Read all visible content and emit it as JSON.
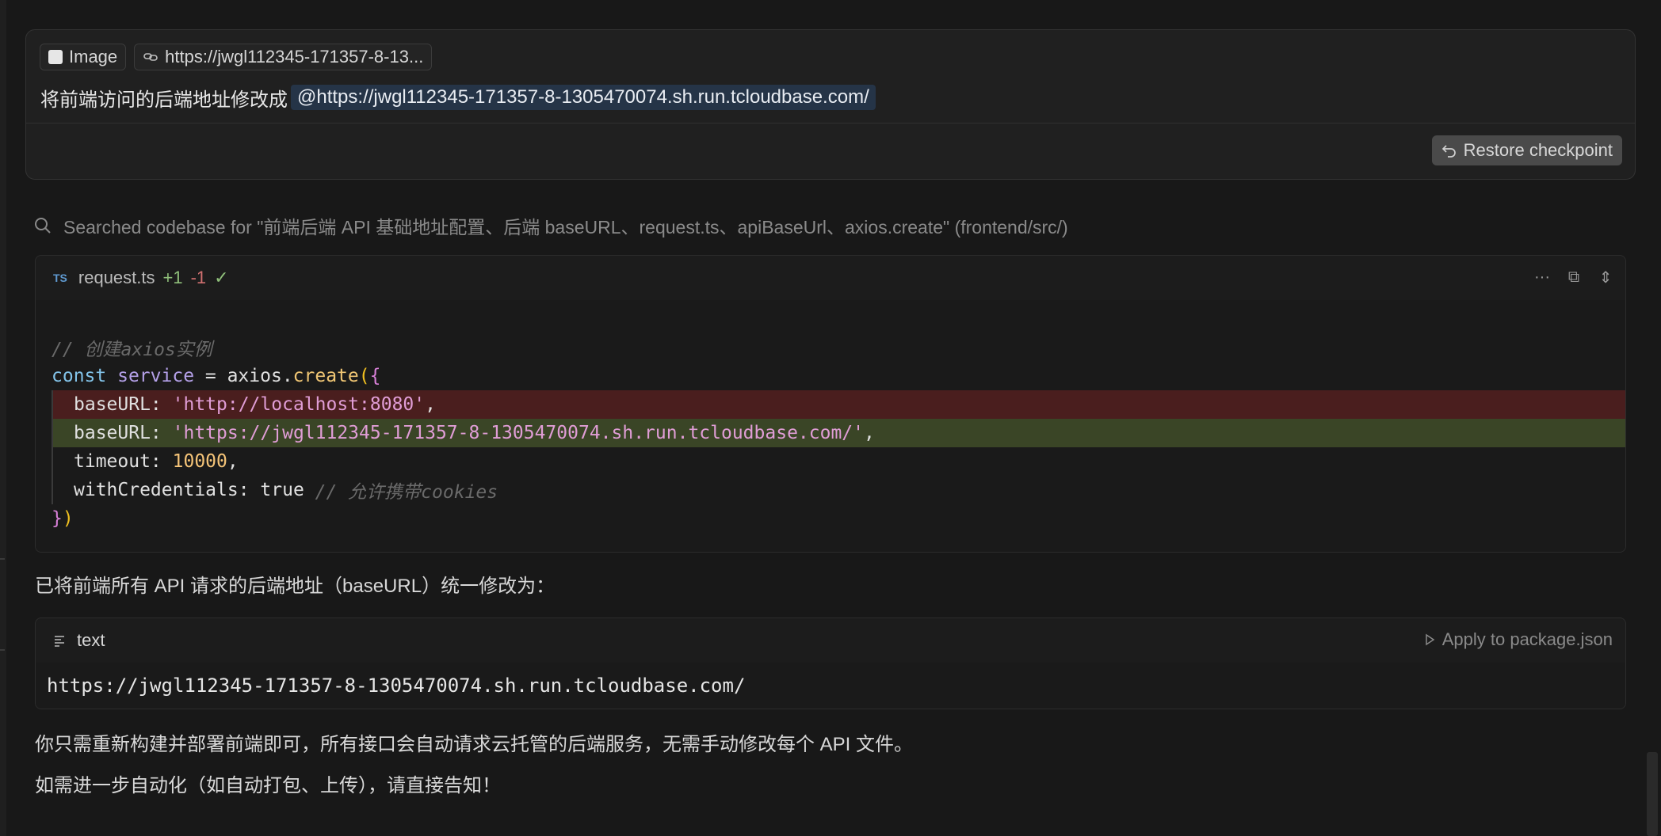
{
  "message": {
    "chips": {
      "image_label": "Image",
      "link_label": "https://jwgl112345-171357-8-13..."
    },
    "text": "将前端访问的后端地址修改成",
    "mention": "@https://jwgl112345-171357-8-1305470074.sh.run.tcloudbase.com/",
    "restore_label": "Restore checkpoint"
  },
  "search": {
    "text": "Searched codebase for \"前端后端 API 基础地址配置、后端 baseURL、request.ts、apiBaseUrl、axios.create\" (frontend/src/)"
  },
  "code_block": {
    "lang_badge": "TS",
    "filename": "request.ts",
    "added": "+1",
    "removed": "-1",
    "check": "✓",
    "actions": {
      "more": "···",
      "copy": "⧉",
      "expand": "⇕"
    },
    "lines": {
      "l1": "// 创建axios实例",
      "l2_kw": "const",
      "l2_var": "service",
      "l2_eq": " = axios.",
      "l2_fn": "create",
      "l2_paren": "(",
      "l2_brace": "{",
      "l3_key": "baseURL: ",
      "l3_val": "'http://localhost:8080'",
      "l3_end": ",",
      "l4_key": "baseURL: ",
      "l4_val": "'https://jwgl112345-171357-8-1305470074.sh.run.tcloudbase.com/'",
      "l4_end": ",",
      "l5_key": "timeout: ",
      "l5_val": "10000",
      "l5_end": ",",
      "l6_key": "withCredentials: true ",
      "l6_comment": "// 允许携带cookies",
      "l7_brace": "}",
      "l7_paren": ")"
    }
  },
  "para1": "已将前端所有 API 请求的后端地址（baseURL）统一修改为：",
  "text_block": {
    "lang": "text",
    "apply_label": "Apply to package.json",
    "content": "https://jwgl112345-171357-8-1305470074.sh.run.tcloudbase.com/"
  },
  "para2": "你只需重新构建并部署前端即可，所有接口会自动请求云托管的后端服务，无需手动修改每个 API 文件。",
  "para3": "如需进一步自动化（如自动打包、上传），请直接告知！",
  "icons": {
    "image": "image-square-icon",
    "link": "link-icon",
    "restore": "undo-arrow-icon",
    "search": "search-icon",
    "text_lines": "text-lines-icon",
    "apply": "play-triangle-icon"
  }
}
